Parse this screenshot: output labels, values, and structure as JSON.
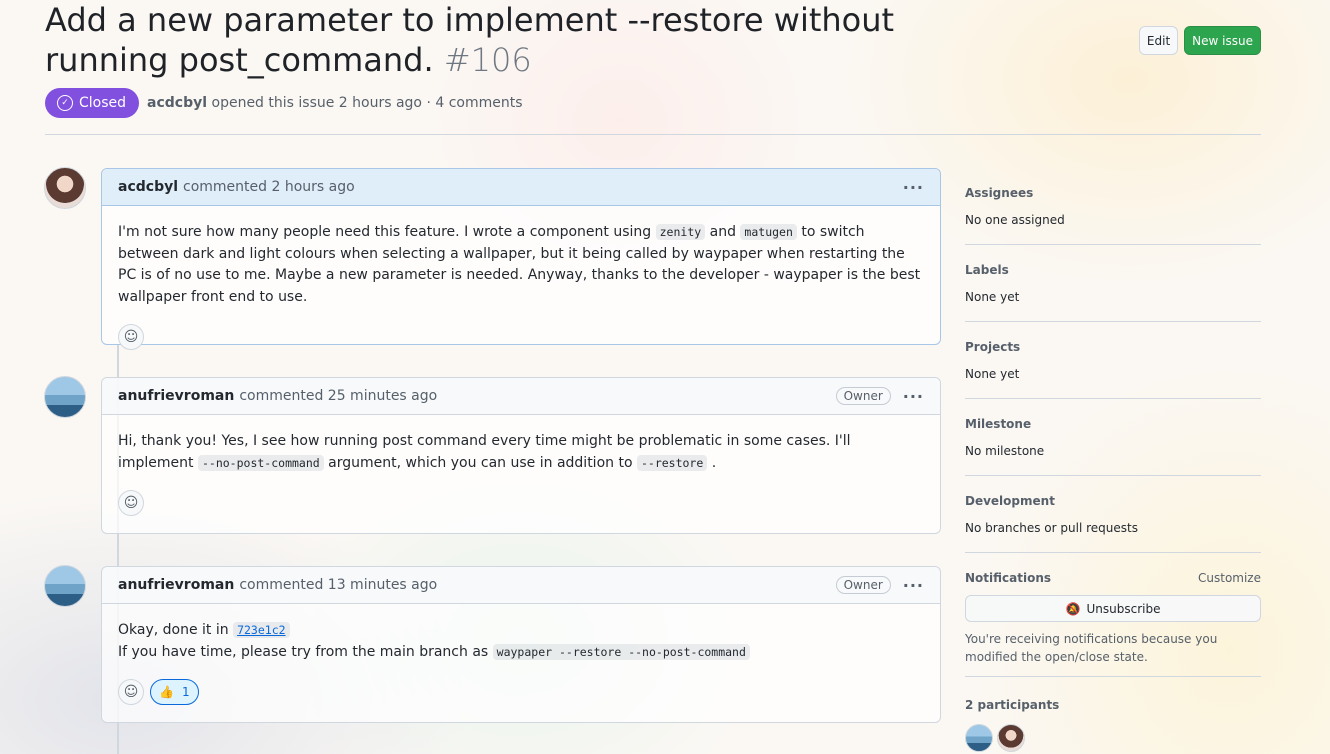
{
  "issue": {
    "title": "Add a new parameter to implement --restore without running post_command.",
    "number": "#106",
    "state": "Closed",
    "author": "acdcbyl",
    "opened_text": "opened this issue 2 hours ago · 4 comments",
    "edit_label": "Edit",
    "new_issue_label": "New issue"
  },
  "comments": [
    {
      "author": "acdcbyl",
      "action": "commented 2 hours ago",
      "owner": "",
      "body": {
        "t1": "I'm not sure how many people need this feature. I wrote a component using ",
        "c1": "zenity",
        "t2": " and ",
        "c2": "matugen",
        "t3": " to switch between dark and light colours when selecting a wallpaper, but it being called by waypaper when restarting the PC is of no use to me. Maybe a new parameter is needed. Anyway, thanks to the developer - waypaper is the best wallpaper front end to use."
      }
    },
    {
      "author": "anufrievroman",
      "action": "commented 25 minutes ago",
      "owner": "Owner",
      "body": {
        "t1": "Hi, thank you! Yes, I see how running post command every time might be problematic in some cases. I'll implement ",
        "c1": "--no-post-command",
        "t2": " argument, which you can use in addition to ",
        "c2": "--restore",
        "t3": " ."
      }
    },
    {
      "author": "anufrievroman",
      "action": "commented 13 minutes ago",
      "owner": "Owner",
      "body": {
        "line1": "Okay, done it in ",
        "sha": "723e1c2",
        "line2": "If you have time, please try from the main branch as ",
        "cmd": "waypaper --restore --no-post-command"
      },
      "reaction": {
        "emoji": "👍",
        "count": "1"
      }
    }
  ],
  "sidebar": {
    "assignees": {
      "label": "Assignees",
      "value": "No one assigned"
    },
    "labels": {
      "label": "Labels",
      "value": "None yet"
    },
    "projects": {
      "label": "Projects",
      "value": "None yet"
    },
    "milestone": {
      "label": "Milestone",
      "value": "No milestone"
    },
    "development": {
      "label": "Development",
      "value": "No branches or pull requests"
    },
    "notifications": {
      "label": "Notifications",
      "customize": "Customize",
      "unsubscribe": "Unsubscribe",
      "note": "You're receiving notifications because you modified the open/close state."
    },
    "participants": {
      "label": "2 participants"
    }
  },
  "icons": {
    "closed": "check-circle-icon",
    "kebab": "kebab-horizontal-icon",
    "smiley": "smiley-icon",
    "bell": "bell-slash-icon"
  },
  "colors": {
    "closed_badge": "#8250df",
    "primary_button": "#2da44e",
    "link": "#0969da"
  }
}
